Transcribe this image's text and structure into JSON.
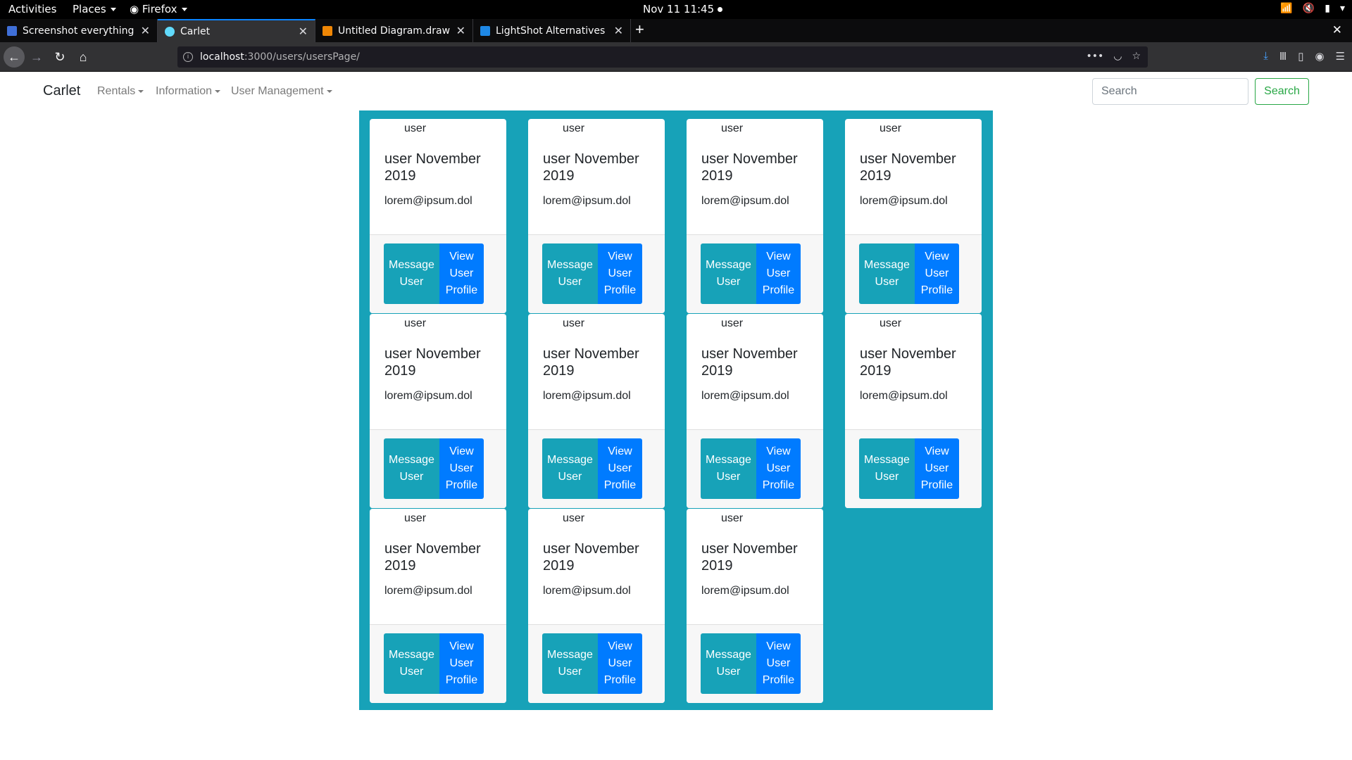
{
  "system_bar": {
    "activities": "Activities",
    "places": "Places",
    "app": "Firefox",
    "clock": "Nov 11  11:45"
  },
  "tabs": [
    {
      "title": "Screenshot everything wi",
      "favicon_color": "#3f6fd8",
      "active": false
    },
    {
      "title": "Carlet",
      "favicon_color": "#61dafb",
      "active": true
    },
    {
      "title": "Untitled Diagram.drawio",
      "favicon_color": "#f08705",
      "active": false
    },
    {
      "title": "LightShot Alternatives fo",
      "favicon_color": "#1e88e5",
      "active": false
    }
  ],
  "url": {
    "host": "localhost",
    "path": ":3000/users/usersPage/"
  },
  "site": {
    "brand": "Carlet",
    "menus": [
      "Rentals",
      "Information",
      "User Management"
    ],
    "search_placeholder": "Search",
    "search_button": "Search"
  },
  "colors": {
    "panel": "#17a2b8",
    "message_button": "#17a2b8",
    "view_button": "#007bff",
    "search_outline": "#28a745"
  },
  "cards": [
    {
      "image_alt": "user",
      "title": "user November 2019",
      "email": "lorem@ipsum.dol",
      "message_label": "Message User",
      "view_label": "View User Profile"
    },
    {
      "image_alt": "user",
      "title": "user November 2019",
      "email": "lorem@ipsum.dol",
      "message_label": "Message User",
      "view_label": "View User Profile"
    },
    {
      "image_alt": "user",
      "title": "user November 2019",
      "email": "lorem@ipsum.dol",
      "message_label": "Message User",
      "view_label": "View User Profile"
    },
    {
      "image_alt": "user",
      "title": "user November 2019",
      "email": "lorem@ipsum.dol",
      "message_label": "Message User",
      "view_label": "View User Profile"
    },
    {
      "image_alt": "user",
      "title": "user November 2019",
      "email": "lorem@ipsum.dol",
      "message_label": "Message User",
      "view_label": "View User Profile"
    },
    {
      "image_alt": "user",
      "title": "user November 2019",
      "email": "lorem@ipsum.dol",
      "message_label": "Message User",
      "view_label": "View User Profile"
    },
    {
      "image_alt": "user",
      "title": "user November 2019",
      "email": "lorem@ipsum.dol",
      "message_label": "Message User",
      "view_label": "View User Profile"
    },
    {
      "image_alt": "user",
      "title": "user November 2019",
      "email": "lorem@ipsum.dol",
      "message_label": "Message User",
      "view_label": "View User Profile"
    },
    {
      "image_alt": "user",
      "title": "user November 2019",
      "email": "lorem@ipsum.dol",
      "message_label": "Message User",
      "view_label": "View User Profile"
    },
    {
      "image_alt": "user",
      "title": "user November 2019",
      "email": "lorem@ipsum.dol",
      "message_label": "Message User",
      "view_label": "View User Profile"
    },
    {
      "image_alt": "user",
      "title": "user November 2019",
      "email": "lorem@ipsum.dol",
      "message_label": "Message User",
      "view_label": "View User Profile"
    }
  ]
}
